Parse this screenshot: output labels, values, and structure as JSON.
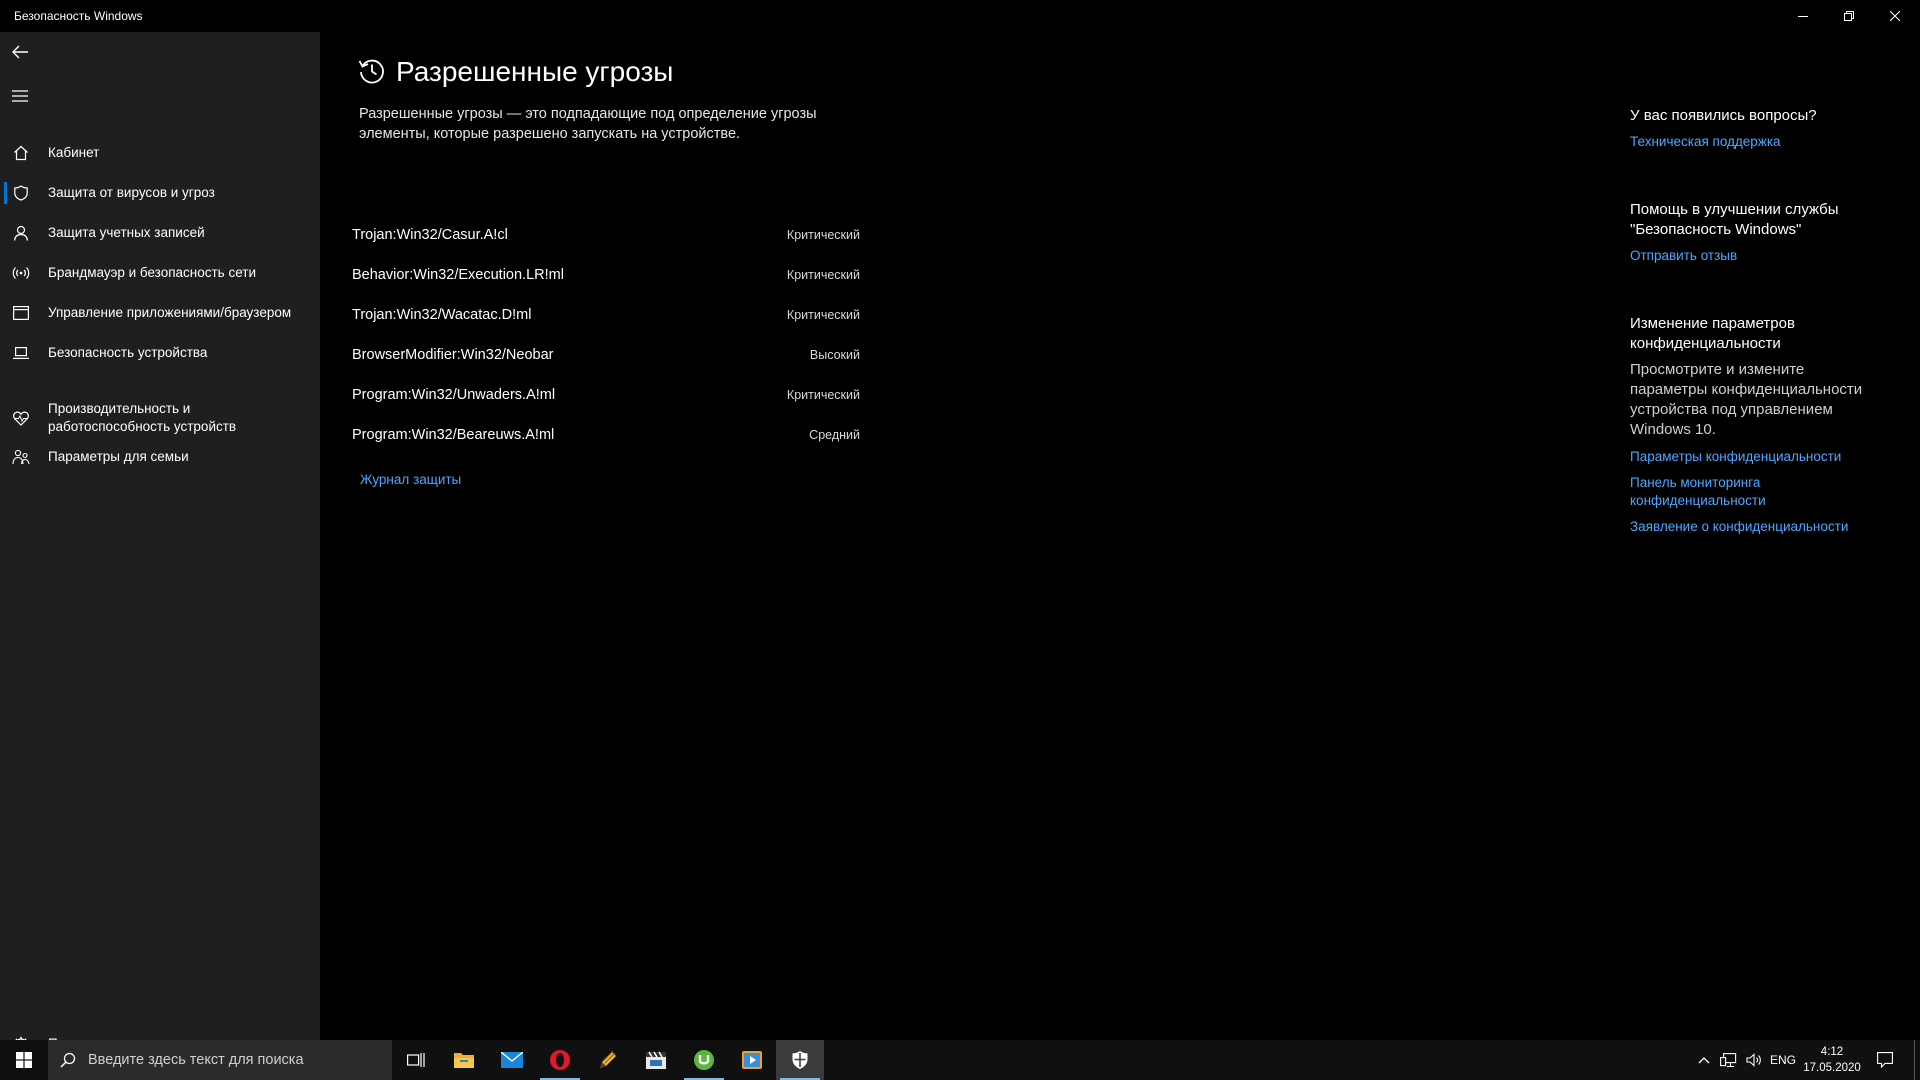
{
  "window": {
    "title": "Безопасность Windows"
  },
  "sidebar": {
    "items": [
      {
        "label": "Кабинет",
        "icon": "home-icon"
      },
      {
        "label": "Защита от вирусов и угроз",
        "icon": "shield-icon",
        "active": true
      },
      {
        "label": "Защита учетных записей",
        "icon": "person-icon"
      },
      {
        "label": "Брандмауэр и безопасность сети",
        "icon": "wireless-icon"
      },
      {
        "label": "Управление приложениями/браузером",
        "icon": "app-browser-icon"
      },
      {
        "label": "Безопасность устройства",
        "icon": "laptop-icon"
      },
      {
        "label": "Производительность и работоспособность устройств",
        "icon": "heart-icon"
      },
      {
        "label": "Параметры для семьи",
        "icon": "family-icon"
      }
    ],
    "settings_label": "Параметры"
  },
  "main": {
    "title": "Разрешенные угрозы",
    "description": "Разрешенные угрозы — это подпадающие под определение угрозы элементы, которые разрешено запускать на устройстве.",
    "threats": [
      {
        "name": "Trojan:Win32/Casur.A!cl",
        "severity": "Критический"
      },
      {
        "name": "Behavior:Win32/Execution.LR!ml",
        "severity": "Критический"
      },
      {
        "name": "Trojan:Win32/Wacatac.D!ml",
        "severity": "Критический"
      },
      {
        "name": "BrowserModifier:Win32/Neobar",
        "severity": "Высокий"
      },
      {
        "name": "Program:Win32/Unwaders.A!ml",
        "severity": "Критический"
      },
      {
        "name": "Program:Win32/Beareuws.A!ml",
        "severity": "Средний"
      }
    ],
    "journal_link": "Журнал защиты"
  },
  "aside": {
    "questions_title": "У вас появились вопросы?",
    "support_link": "Техническая поддержка",
    "improve_title": "Помощь в улучшении службы \"Безопасность Windows\"",
    "feedback_link": "Отправить отзыв",
    "privacy_title": "Изменение параметров конфиденциальности",
    "privacy_text": "Просмотрите и измените параметры конфиденциальности устройства под управлением Windows 10.",
    "privacy_links": [
      "Параметры конфиденциальности",
      "Панель мониторинга конфиденциальности",
      "Заявление о конфиденциальности"
    ]
  },
  "taskbar": {
    "search_placeholder": "Введите здесь текст для поиска",
    "language": "ENG",
    "time": "4:12",
    "date": "17.05.2020"
  },
  "colors": {
    "accent": "#0078d7",
    "link": "#4da6ff",
    "sidebar_bg": "#1f1f1f"
  }
}
